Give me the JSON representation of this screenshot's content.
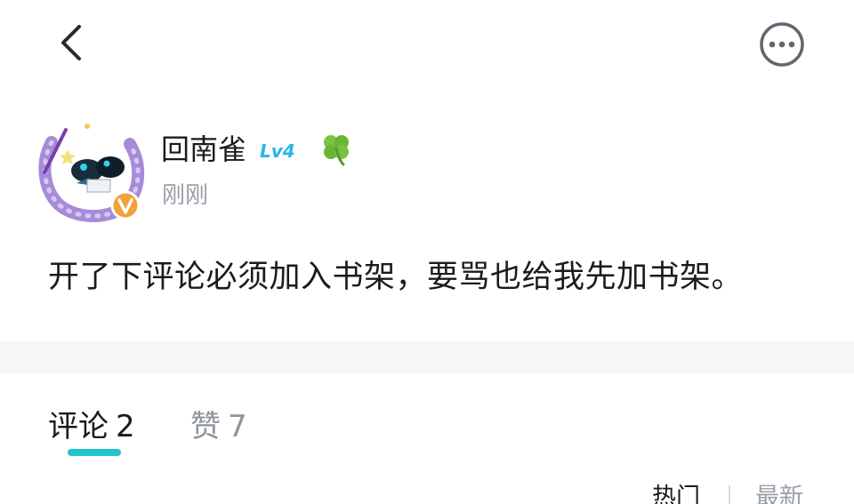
{
  "topbar": {
    "back_icon": "chevron-left-icon",
    "more_icon": "more-horizontal-circle-icon"
  },
  "author": {
    "name": "回南雀",
    "level": "Lv4",
    "badge_icon": "four-leaf-clover-icon",
    "verified_icon": "verified-v-icon",
    "time": "刚刚"
  },
  "post": {
    "content": "开了下评论必须加入书架，要骂也给我先加书架。"
  },
  "tabs": [
    {
      "label": "评论",
      "count": "2",
      "active": true
    },
    {
      "label": "赞",
      "count": "7",
      "active": false
    }
  ],
  "sort": {
    "hot": "热门",
    "new": "最新"
  },
  "colors": {
    "accent": "#23c4cc",
    "level": "#29b6e8",
    "muted": "#9aa0a8",
    "band": "#f5f6f8"
  }
}
